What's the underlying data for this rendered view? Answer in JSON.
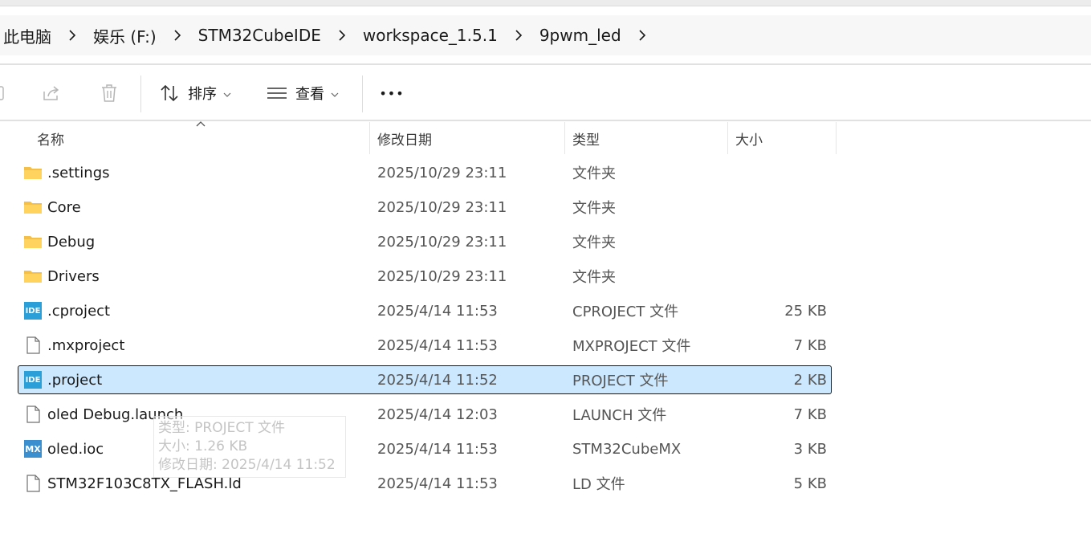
{
  "breadcrumb": [
    "此电脑",
    "娱乐 (F:)",
    "STM32CubeIDE",
    "workspace_1.5.1",
    "9pwm_led"
  ],
  "toolbar": {
    "sort_label": "排序",
    "view_label": "查看",
    "more_label": "•••"
  },
  "columns": {
    "name": "名称",
    "modified": "修改日期",
    "type": "类型",
    "size": "大小"
  },
  "files": [
    {
      "name": ".settings",
      "modified": "2025/10/29 23:11",
      "type": "文件夹",
      "size": "",
      "icon": "folder-icon"
    },
    {
      "name": "Core",
      "modified": "2025/10/29 23:11",
      "type": "文件夹",
      "size": "",
      "icon": "folder-icon"
    },
    {
      "name": "Debug",
      "modified": "2025/10/29 23:11",
      "type": "文件夹",
      "size": "",
      "icon": "folder-icon"
    },
    {
      "name": "Drivers",
      "modified": "2025/10/29 23:11",
      "type": "文件夹",
      "size": "",
      "icon": "folder-icon"
    },
    {
      "name": ".cproject",
      "modified": "2025/4/14 11:53",
      "type": "CPROJECT 文件",
      "size": "25 KB",
      "icon": "ide-file-icon"
    },
    {
      "name": ".mxproject",
      "modified": "2025/4/14 11:53",
      "type": "MXPROJECT 文件",
      "size": "7 KB",
      "icon": "blank-file-icon"
    },
    {
      "name": ".project",
      "modified": "2025/4/14 11:52",
      "type": "PROJECT 文件",
      "size": "2 KB",
      "icon": "ide-file-icon",
      "selected": true
    },
    {
      "name": "oled Debug.launch",
      "modified": "2025/4/14 12:03",
      "type": "LAUNCH 文件",
      "size": "7 KB",
      "icon": "blank-file-icon"
    },
    {
      "name": "oled.ioc",
      "modified": "2025/4/14 11:53",
      "type": "STM32CubeMX",
      "size": "3 KB",
      "icon": "mx-file-icon"
    },
    {
      "name": "STM32F103C8TX_FLASH.ld",
      "modified": "2025/4/14 11:53",
      "type": "LD 文件",
      "size": "5 KB",
      "icon": "blank-file-icon"
    }
  ],
  "icon_labels": {
    "ide": "IDE",
    "mx": "MX"
  },
  "tooltip": {
    "type": "类型: PROJECT 文件",
    "size": "大小: 1.26 KB",
    "modified": "修改日期: 2025/4/14 11:52"
  },
  "colors": {
    "selection": "#cce8ff",
    "folder": "#f5c04a",
    "ide_badge": "#2a9fd8",
    "mx_badge": "#3c8fcf"
  }
}
